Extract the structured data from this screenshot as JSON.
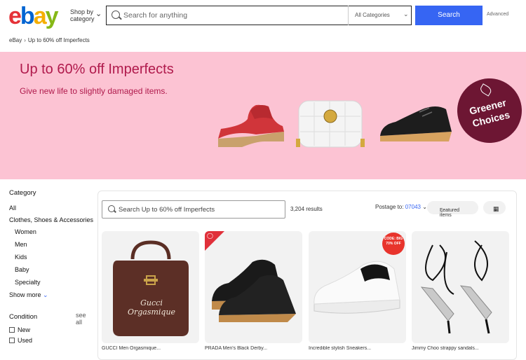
{
  "header": {
    "logo_letters": [
      "e",
      "b",
      "a",
      "y"
    ],
    "shop_by_line1": "Shop by",
    "shop_by_line2": "category",
    "search_placeholder": "Search for anything",
    "category_select": "All Categories",
    "search_button": "Search",
    "advanced": "Advanced"
  },
  "breadcrumb": [
    "eBay",
    "Up to 60% off Imperfects"
  ],
  "banner": {
    "title": "Up to 60% off Imperfects",
    "subtitle": "Give new life to slightly damaged items.",
    "badge_line1": "Greener",
    "badge_line2": "Choices",
    "bg_color": "#fcc3d3",
    "accent_color": "#b01a4c"
  },
  "sidebar": {
    "category_title": "Category",
    "all": "All",
    "group": "Clothes, Shoes & Accessories",
    "items": [
      "Women",
      "Men",
      "Kids",
      "Baby",
      "Specialty"
    ],
    "show_more": "Show more",
    "condition_title": "Condition",
    "see_all": "see all",
    "conditions": [
      "New",
      "Used"
    ]
  },
  "results": {
    "search_placeholder": "Search Up to 60% off Imperfects",
    "count": "3,204 results",
    "postage_label": "Postage to:",
    "postage_zip": "07043",
    "sort": "Featured items",
    "view_icon": "grid-view-icon"
  },
  "products": [
    {
      "title": "GUCCI Men Orgasmique...",
      "image": "brown-handbag",
      "label": "Gucci Orgasmique"
    },
    {
      "title": "PRADA Men's Black Derby...",
      "image": "black-derby-shoes"
    },
    {
      "title": "Incredible stylish Sneakers...",
      "image": "white-sneaker",
      "badge_line1": "CODE: BIG",
      "badge_line2": "70% OFF"
    },
    {
      "title": "Jimmy Choo strappy sandals...",
      "image": "strappy-heels"
    }
  ],
  "colors": {
    "brand_blue": "#3665f3",
    "ebay_red": "#e53238",
    "ebay_blue": "#0064d2",
    "ebay_yellow": "#f5af02",
    "ebay_green": "#86b817"
  }
}
